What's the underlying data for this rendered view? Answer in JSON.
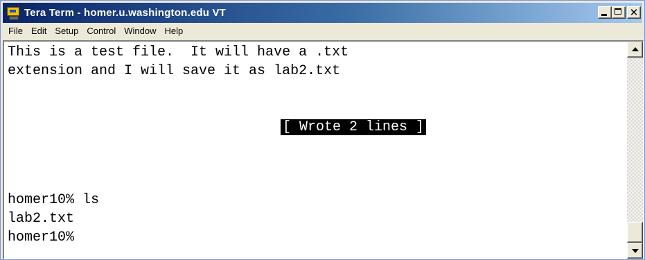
{
  "window": {
    "title": "Tera Term - homer.u.washington.edu VT"
  },
  "menu": {
    "items": [
      "File",
      "Edit",
      "Setup",
      "Control",
      "Window",
      "Help"
    ]
  },
  "terminal": {
    "line1": "This is a test file.  It will have a .txt",
    "line2": "extension and I will save it as lab2.txt",
    "status": "[ Wrote 2 lines ]",
    "line4": "homer10% ls",
    "line5": "lab2.txt",
    "line6": "homer10%"
  },
  "icons": {
    "app": "tera-term-icon",
    "minimize": "minimize-icon",
    "maximize": "maximize-icon",
    "close": "close-icon",
    "scroll_up": "scroll-up-arrow-icon",
    "scroll_down": "scroll-down-arrow-icon"
  },
  "colors": {
    "titlebar_start": "#0a246a",
    "titlebar_end": "#a6caf0",
    "terminal_bg": "#ffffff",
    "terminal_fg": "#000000",
    "status_bg": "#000000",
    "status_fg": "#ffffff"
  }
}
